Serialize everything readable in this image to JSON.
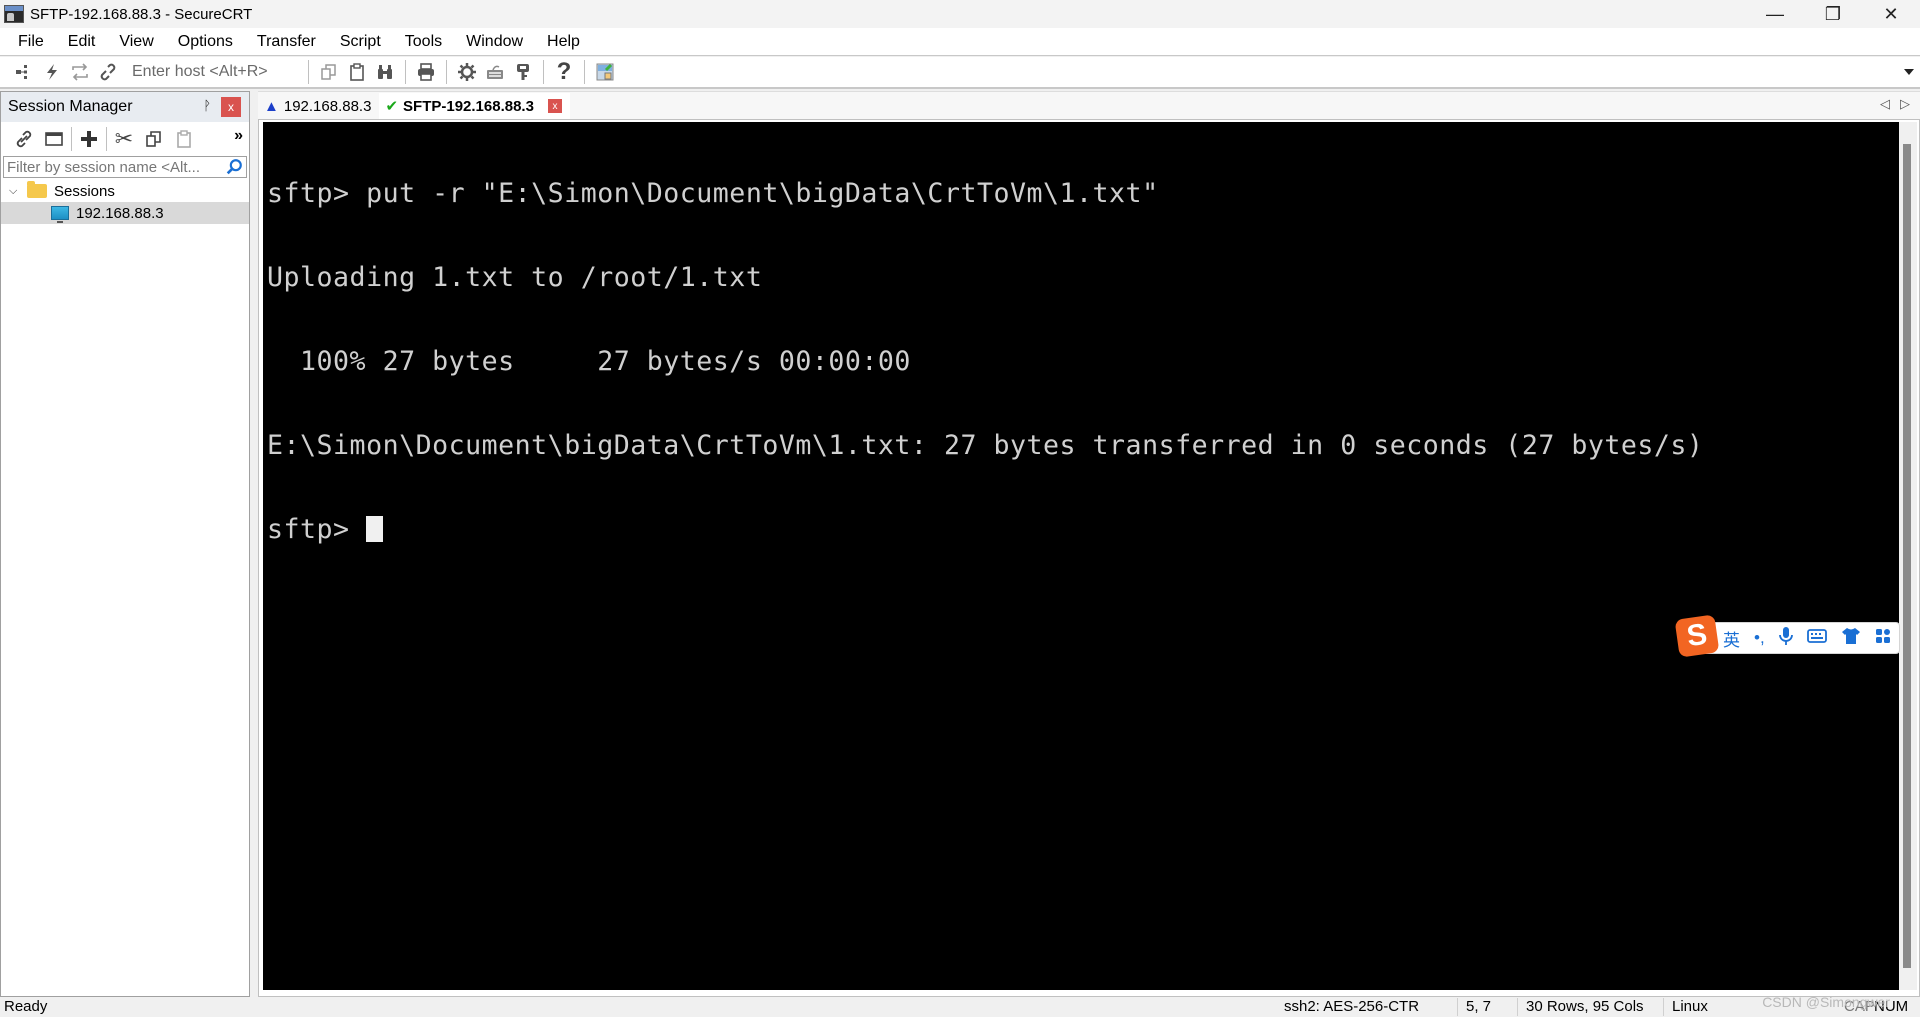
{
  "window": {
    "title": "SFTP-192.168.88.3 - SecureCRT",
    "controls": {
      "minimize": "—",
      "restore": "❐",
      "close": "✕"
    }
  },
  "menu": [
    "File",
    "Edit",
    "View",
    "Options",
    "Transfer",
    "Script",
    "Tools",
    "Window",
    "Help"
  ],
  "toolbar": {
    "host_placeholder": "Enter host <Alt+R>",
    "icons": [
      "connect-in-tab-icon",
      "quick-connect-icon",
      "reconnect-icon",
      "disconnect-icon",
      "copy-icon",
      "paste-icon",
      "find-icon",
      "print-icon",
      "settings-icon",
      "keymap-icon",
      "keygen-icon",
      "help-icon",
      "sftp-icon"
    ]
  },
  "session_manager": {
    "title": "Session Manager",
    "pin": "ᚹ",
    "close": "x",
    "more": "»",
    "filter_placeholder": "Filter by session name <Alt...",
    "tree": {
      "folder_label": "Sessions",
      "items": [
        {
          "label": "192.168.88.3",
          "selected": true
        }
      ]
    }
  },
  "tabs": [
    {
      "label": "192.168.88.3",
      "status_icon": "warning-icon",
      "glyph": "▲",
      "active": false
    },
    {
      "label": "SFTP-192.168.88.3",
      "status_icon": "check-icon",
      "glyph": "✔",
      "active": true,
      "close": "x"
    }
  ],
  "tab_nav": {
    "prev": "◁",
    "next": "▷"
  },
  "terminal": {
    "lines": [
      "sftp> put -r \"E:\\Simon\\Document\\bigData\\CrtToVm\\1.txt\"",
      "Uploading 1.txt to /root/1.txt",
      "  100% 27 bytes     27 bytes/s 00:00:00",
      "E:\\Simon\\Document\\bigData\\CrtToVm\\1.txt: 27 bytes transferred in 0 seconds (27 bytes/s)",
      "sftp> "
    ]
  },
  "ime": {
    "logo": "S",
    "mode": "英",
    "punct": "•,",
    "mic": "🎤",
    "keyboard": "⌨",
    "skin": "👕",
    "apps": "▦"
  },
  "status": {
    "ready": "Ready",
    "cipher": "ssh2: AES-256-CTR",
    "cursor_pos": "5,   7",
    "size": "30 Rows, 95 Cols",
    "os": "Linux",
    "caps": "CAP",
    "num": "NUM",
    "watermark": "CSDN @Simongwer"
  }
}
